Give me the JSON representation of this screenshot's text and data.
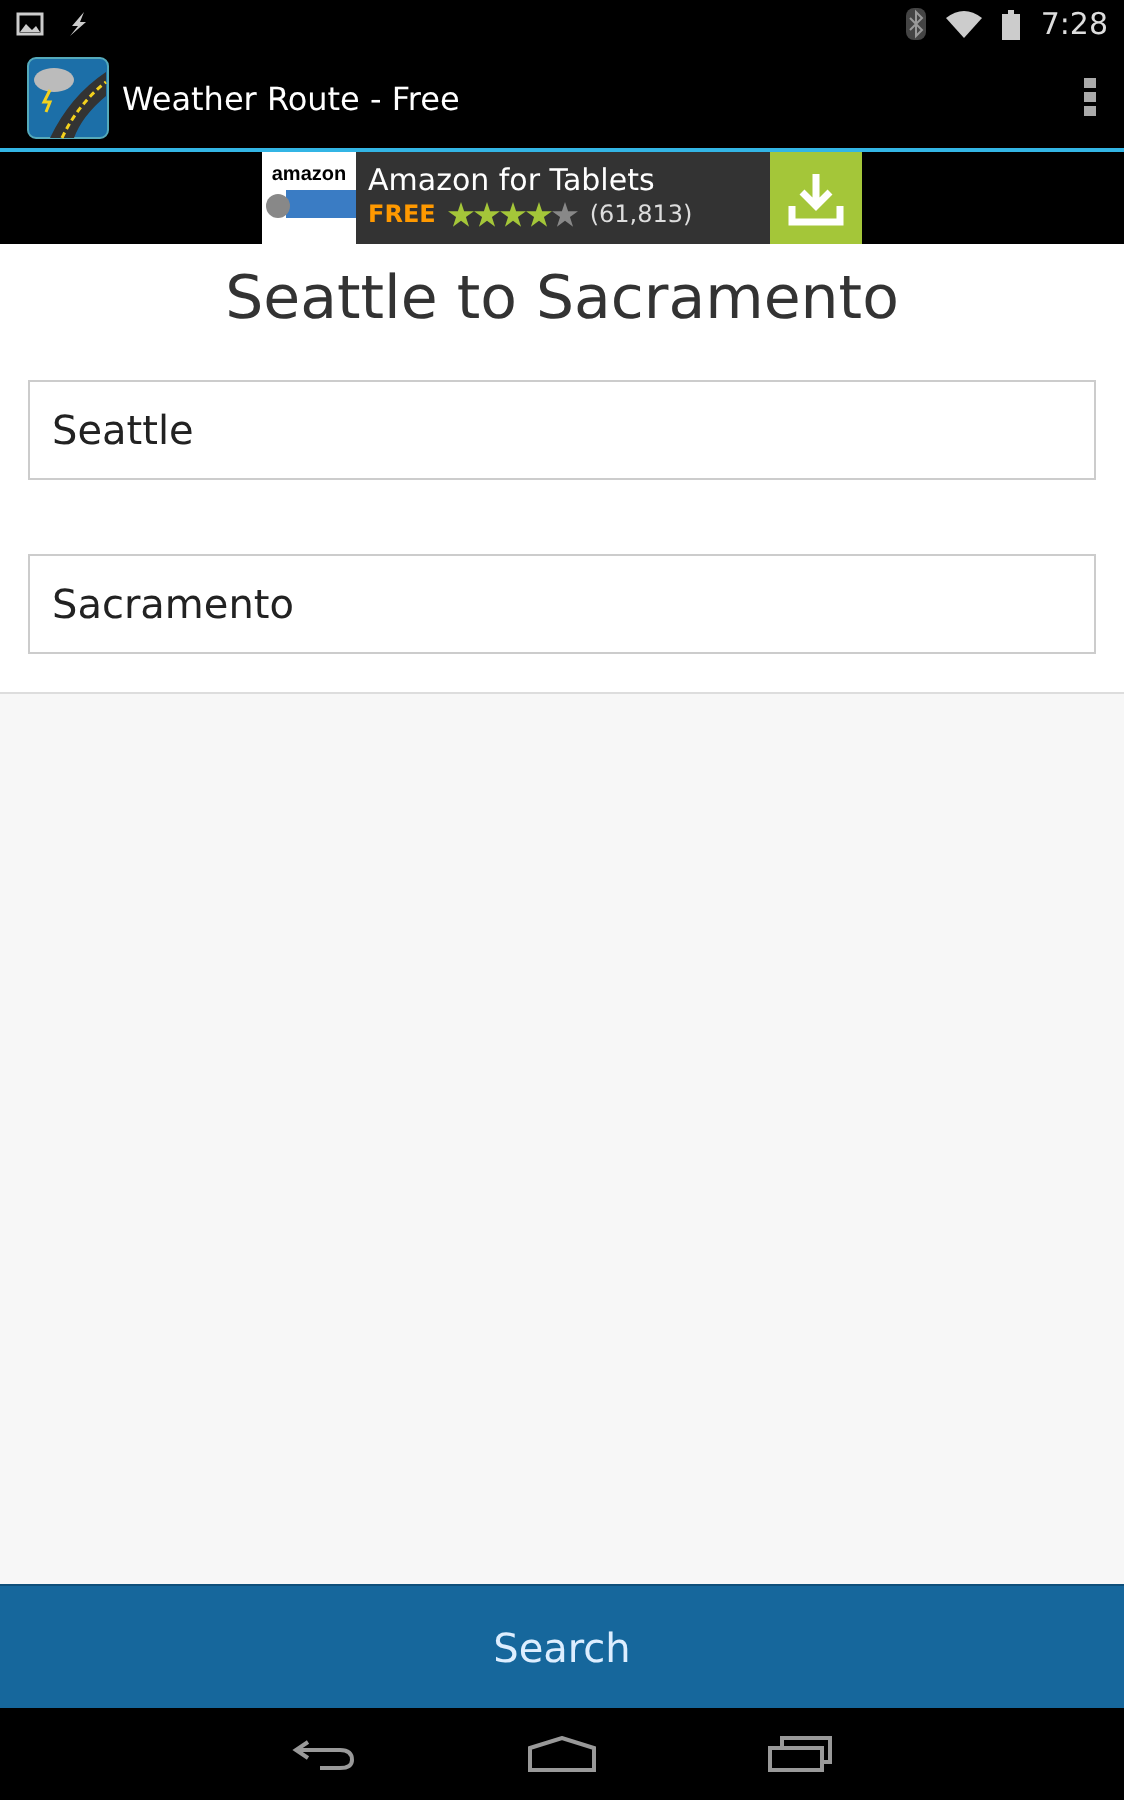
{
  "status_bar": {
    "time": "7:28"
  },
  "action_bar": {
    "title": "Weather Route - Free"
  },
  "ad": {
    "logo": "amazon",
    "title": "Amazon for Tablets",
    "price": "FREE",
    "stars": 4,
    "count": "(61,813)"
  },
  "route": {
    "title": "Seattle to Sacramento",
    "from": "Seattle",
    "to": "Sacramento"
  },
  "search_button": "Search"
}
